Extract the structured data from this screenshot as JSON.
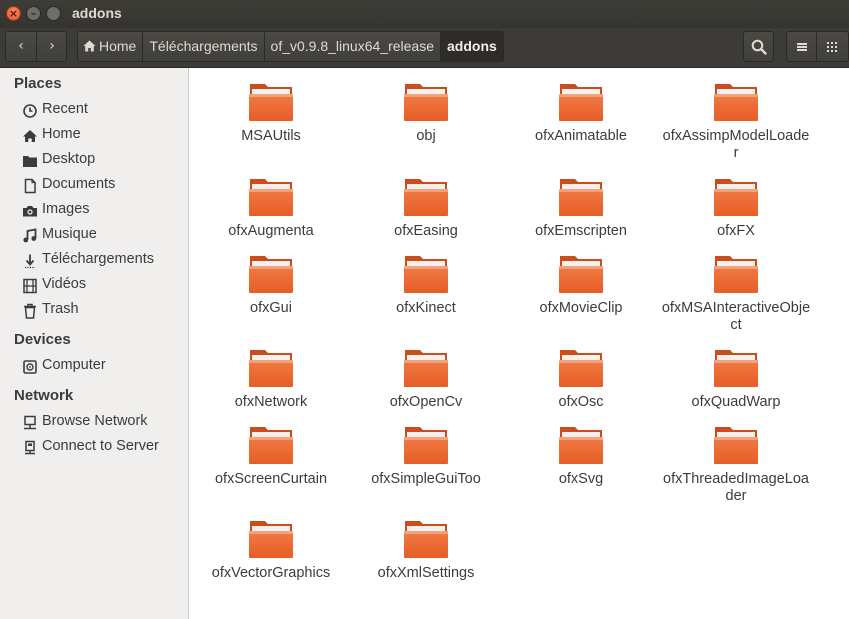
{
  "window": {
    "title": "addons",
    "close_glyph": "×",
    "min_glyph": "–"
  },
  "toolbar": {
    "back_icon": "‹",
    "forward_icon": "›",
    "breadcrumbs": [
      "Home",
      "Téléchargements",
      "of_v0.9.8_linux64_release",
      "addons"
    ]
  },
  "sidebar": {
    "places_header": "Places",
    "places": [
      {
        "label": "Recent",
        "icon": "clock-icon"
      },
      {
        "label": "Home",
        "icon": "home-icon"
      },
      {
        "label": "Desktop",
        "icon": "folder-icon"
      },
      {
        "label": "Documents",
        "icon": "document-icon"
      },
      {
        "label": "Images",
        "icon": "camera-icon"
      },
      {
        "label": "Musique",
        "icon": "music-icon"
      },
      {
        "label": "Téléchargements",
        "icon": "download-icon"
      },
      {
        "label": "Vidéos",
        "icon": "film-icon"
      },
      {
        "label": "Trash",
        "icon": "trash-icon"
      }
    ],
    "devices_header": "Devices",
    "devices": [
      {
        "label": "Computer",
        "icon": "drive-icon"
      }
    ],
    "network_header": "Network",
    "network": [
      {
        "label": "Browse Network",
        "icon": "network-icon"
      },
      {
        "label": "Connect to Server",
        "icon": "server-icon"
      }
    ]
  },
  "files": [
    "MSAUtils",
    "obj",
    "ofxAnimatable",
    "ofxAssimpModelLoader",
    "ofxAugmenta",
    "ofxEasing",
    "ofxEmscripten",
    "ofxFX",
    "ofxGui",
    "ofxKinect",
    "ofxMovieClip",
    "ofxMSAInteractiveObject",
    "ofxNetwork",
    "ofxOpenCv",
    "ofxOsc",
    "ofxQuadWarp",
    "ofxScreenCurtain",
    "ofxSimpleGuiToo",
    "ofxSvg",
    "ofxThreadedImageLoader",
    "ofxVectorGraphics",
    "ofxXmlSettings"
  ],
  "colors": {
    "folder_top": "#f3a27e",
    "folder_body": "#e75d26",
    "titlebar": "#3c3b37",
    "sidebar_bg": "#f0efed"
  }
}
